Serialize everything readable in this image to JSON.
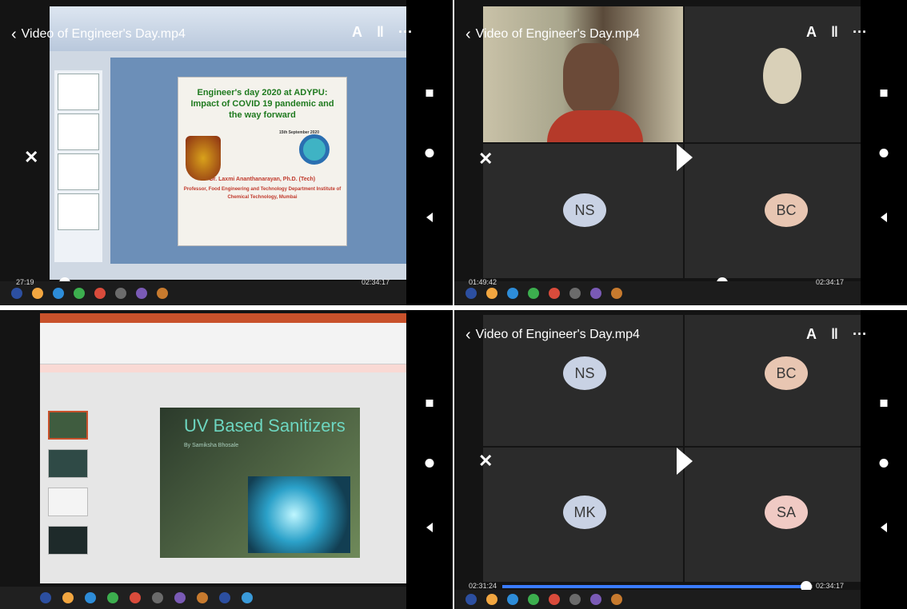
{
  "panels": {
    "p1": {
      "title": "Video of Engineer's Day.mp4",
      "time_elapsed": "27:19",
      "time_total": "02:34:17",
      "progress": 0.16,
      "slide": {
        "title": "Engineer's day 2020 at ADYPU: Impact of COVID 19 pandemic and the way forward",
        "date": "15th September 2020",
        "speaker": "Dr. Laxmi Ananthanarayan, Ph.D. (Tech)",
        "affiliation": "Professor, Food Engineering and Technology Department Institute of Chemical Technology, Mumbai"
      }
    },
    "p2": {
      "title": "Video of Engineer's Day.mp4",
      "time_elapsed": "01:49:42",
      "time_total": "02:34:17",
      "progress": 0.71,
      "participants": [
        "NS",
        "BC"
      ]
    },
    "p3": {
      "slide": {
        "title": "UV Based Sanitizers",
        "byline": "By Samiksha Bhosale"
      }
    },
    "p4": {
      "title": "Video of Engineer's Day.mp4",
      "time_elapsed": "02:31:24",
      "time_total": "02:34:17",
      "progress": 0.98,
      "participants": [
        "NS",
        "BC",
        "MK",
        "SA"
      ]
    }
  },
  "toolbar": {
    "font_icon": "A",
    "filter_icon": "‖",
    "more_icon": "···"
  },
  "colors": {
    "accent": "#3a7bff",
    "avatar_blue": "#c9d2e4",
    "avatar_peach": "#e8c6b2",
    "avatar_pink": "#f0cac4"
  }
}
